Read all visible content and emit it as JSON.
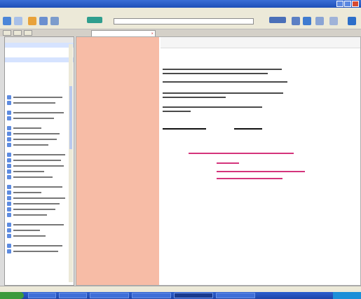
{
  "window": {
    "title": ""
  },
  "menu": {
    "items": [
      "",
      "",
      "",
      "",
      "",
      ""
    ]
  },
  "address_bar": {
    "value": ""
  },
  "tabs": {
    "left": [
      "",
      "",
      ""
    ],
    "active_label": "",
    "close_glyph": "×"
  },
  "sidebar": {
    "header": "",
    "rows": [
      "",
      "",
      "",
      ""
    ]
  },
  "nav_pane": {
    "title": "",
    "heading": "",
    "links": [
      "",
      "",
      "",
      "",
      "",
      ""
    ]
  },
  "document": {
    "top_text": "",
    "heading": "",
    "paragraphs": [
      "",
      "",
      "",
      ""
    ],
    "left_label": "",
    "right_label": "",
    "links": [
      "",
      "",
      "",
      ""
    ]
  },
  "status_bar": {
    "text": ""
  },
  "taskbar": {
    "start_label": "",
    "items": [
      "",
      "",
      "",
      "",
      "",
      ""
    ],
    "clock": ""
  },
  "colors": {
    "accent_blue": "#1e4fb8",
    "nav_pane_bg": "#f7bca6",
    "link_pink": "#d4347c",
    "start_green": "#3c9a3c"
  },
  "icons": [
    "back-icon",
    "forward-icon",
    "home-icon",
    "search-icon",
    "bookmark-icon",
    "print-icon",
    "close-icon"
  ]
}
